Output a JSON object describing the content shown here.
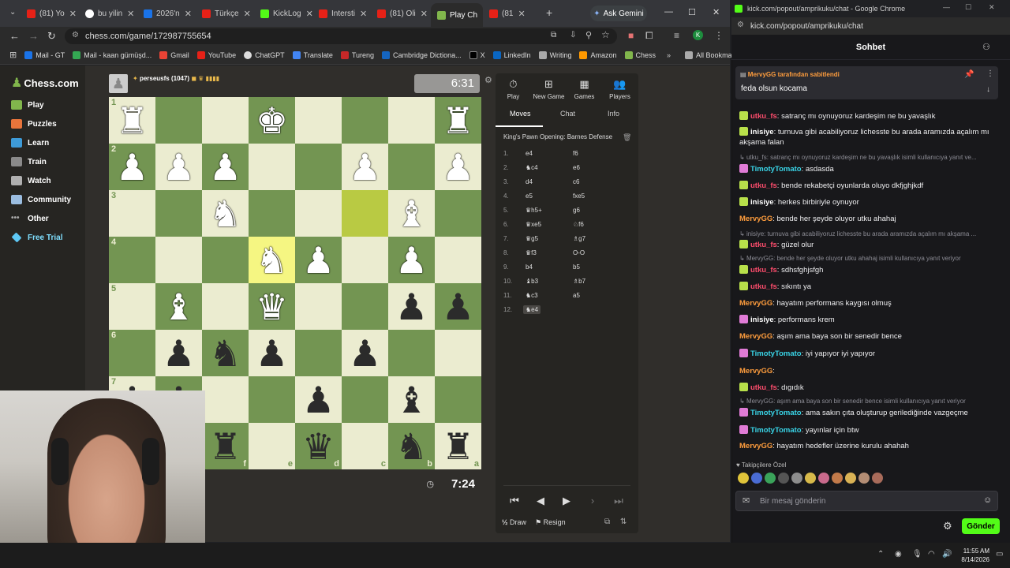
{
  "tabs": [
    {
      "label": "(81) Yo"
    },
    {
      "label": "bu yilin"
    },
    {
      "label": "2026'n"
    },
    {
      "label": "Türkçe"
    },
    {
      "label": "KickLog"
    },
    {
      "label": "Intersti"
    },
    {
      "label": "(81) Oli"
    },
    {
      "label": "Play Ch"
    },
    {
      "label": "(81"
    }
  ],
  "ask_gemini": "Ask Gemini",
  "address": "chess.com/game/172987755654",
  "bookmarks": [
    "Mail - GT",
    "Mail - kaan gümüşd...",
    "Gmail",
    "YouTube",
    "ChatGPT",
    "Translate",
    "Tureng",
    "Cambridge Dictiona...",
    "X",
    "LinkedIn",
    "Writing",
    "Amazon",
    "Chess"
  ],
  "all_bookmarks": "All Bookmarks",
  "site_logo": "Chess.com",
  "nav": [
    "Play",
    "Puzzles",
    "Learn",
    "Train",
    "Watch",
    "Community",
    "Other",
    "Free Trial"
  ],
  "opponent": {
    "name": "perseusfs (1047)",
    "clock": "6:31"
  },
  "player": {
    "clock": "7:24"
  },
  "ranks": [
    "1",
    "2",
    "3",
    "4",
    "5",
    "6",
    "7"
  ],
  "files": [
    "f",
    "e",
    "d",
    "c",
    "b",
    "a"
  ],
  "panel_tabs": [
    "Play",
    "New Game",
    "Games",
    "Players"
  ],
  "sub_tabs": [
    "Moves",
    "Chat",
    "Info"
  ],
  "opening": "King's Pawn Opening: Barnes Defense",
  "moves": [
    {
      "n": "1.",
      "w": "e4",
      "b": "f6"
    },
    {
      "n": "2.",
      "w": "♞c4",
      "b": "e6"
    },
    {
      "n": "3.",
      "w": "d4",
      "b": "c6"
    },
    {
      "n": "4.",
      "w": "e5",
      "b": "fxe5"
    },
    {
      "n": "5.",
      "w": "♛h5+",
      "b": "g6"
    },
    {
      "n": "6.",
      "w": "♛xe5",
      "b": "♘f6"
    },
    {
      "n": "7.",
      "w": "♛g5",
      "b": "♗g7"
    },
    {
      "n": "8.",
      "w": "♛f3",
      "b": "O-O"
    },
    {
      "n": "9.",
      "w": "b4",
      "b": "b5"
    },
    {
      "n": "10.",
      "w": "♝b3",
      "b": "♗b7"
    },
    {
      "n": "11.",
      "w": "♞c3",
      "b": "a5"
    },
    {
      "n": "12.",
      "w": "♞e4",
      "b": ""
    }
  ],
  "draw": "Draw",
  "resign": "Resign",
  "chat_window_title": "kick.com/popout/amprikuku/chat - Google Chrome",
  "chat_address": "kick.com/popout/amprikuku/chat",
  "chat_title": "Sohbet",
  "pinned": {
    "header": "MervyGG tarafından sabitlendi",
    "text": "feda olsun kocama"
  },
  "messages": [
    {
      "user": "utku_fs",
      "color": "#ff4d6d",
      "text": ": satranç mı oynuyoruz kardeşim ne bu yavaşlık",
      "badge": "#b8e04a"
    },
    {
      "user": "inisiye",
      "color": "#ffffff",
      "text": ": turnuva gibi acabiliyoruz lichesste bu arada aramızda açalım mı akşama falan",
      "badge": "#b8e04a"
    },
    {
      "reply": "utku_fs: satranç mı oynuyoruz kardeşim ne bu yavaşlık isimli kullanıcıya yanıt ve..."
    },
    {
      "user": "TimotyTomato",
      "color": "#39d5e8",
      "text": ": asdasda",
      "badge": "#e07bd6"
    },
    {
      "user": "utku_fs",
      "color": "#ff4d6d",
      "text": ": bende rekabetçi oyunlarda oluyo dkfjghjkdf",
      "badge": "#b8e04a"
    },
    {
      "user": "inisiye",
      "color": "#ffffff",
      "text": ": herkes birbiriyle oynuyor",
      "badge": "#b8e04a"
    },
    {
      "user": "MervyGG",
      "color": "#ff9d3d",
      "text": ": bende her şeyde oluyor utku ahahaj"
    },
    {
      "reply": "inisiye: turnuva gibi acabiliyoruz lichesste bu arada aramızda açalım mı akşama ..."
    },
    {
      "user": "utku_fs",
      "color": "#ff4d6d",
      "text": ": güzel olur",
      "badge": "#b8e04a"
    },
    {
      "reply": "MervyGG: bende her şeyde oluyor utku ahahaj isimli kullanıcıya yanıt veriyor"
    },
    {
      "user": "utku_fs",
      "color": "#ff4d6d",
      "text": ": sdhsfghjsfgh",
      "badge": "#b8e04a"
    },
    {
      "user": "utku_fs",
      "color": "#ff4d6d",
      "text": ": sıkıntı ya",
      "badge": "#b8e04a"
    },
    {
      "user": "MervyGG",
      "color": "#ff9d3d",
      "text": ": hayatım performans kaygısı olmuş"
    },
    {
      "user": "inisiye",
      "color": "#ffffff",
      "text": ": performans krem",
      "badge": "#e07bd6"
    },
    {
      "user": "MervyGG",
      "color": "#ff9d3d",
      "text": ": aşım ama baya son bir senedir bence"
    },
    {
      "user": "TimotyTomato",
      "color": "#39d5e8",
      "text": ": iyi yapıyor iyi yapıyor",
      "badge": "#e07bd6"
    },
    {
      "user": "MervyGG",
      "color": "#ff9d3d",
      "text": ":"
    },
    {
      "user": "utku_fs",
      "color": "#ff4d6d",
      "text": ": dıgıdık",
      "badge": "#b8e04a"
    },
    {
      "reply": "MervyGG: aşım ama baya son bir senedir bence isimli kullanıcıya yanıt veriyor"
    },
    {
      "user": "TimotyTomato",
      "color": "#39d5e8",
      "text": ": ama sakın çıta oluşturup gerilediğinde vazgeçme",
      "badge": "#e07bd6"
    },
    {
      "user": "TimotyTomato",
      "color": "#39d5e8",
      "text": ": yayınlar için btw",
      "badge": "#e07bd6"
    },
    {
      "user": "MervyGG",
      "color": "#ff9d3d",
      "text": ": hayatım hedefler üzerine kurulu ahahah"
    }
  ],
  "followers_label": "Takipçilere Özel",
  "chat_placeholder": "Bir mesaj gönderin",
  "send": "Gönder",
  "clock_time": "11:55 AM",
  "clock_date": "8/14/2026"
}
